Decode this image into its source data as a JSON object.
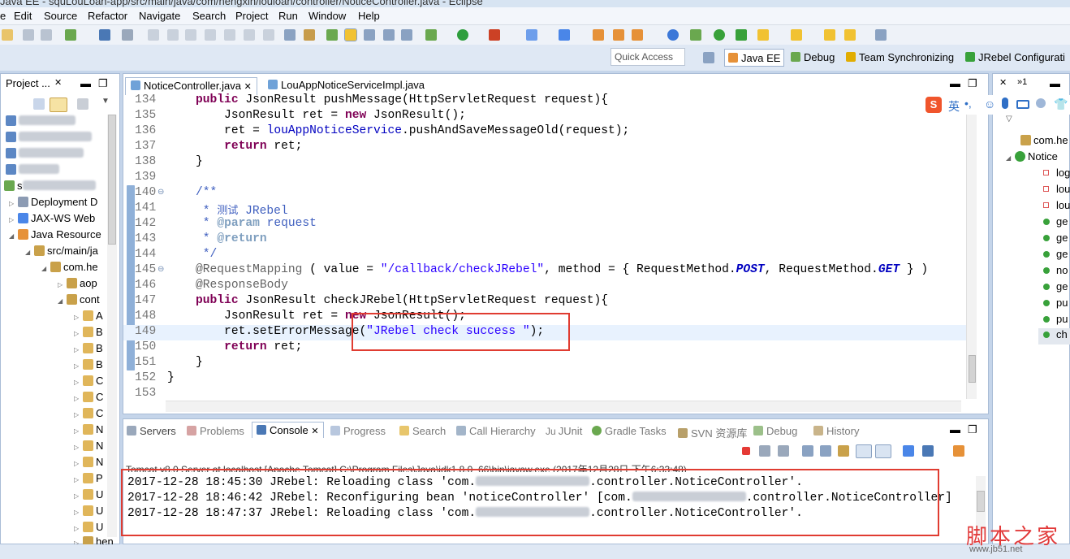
{
  "window": {
    "title": "Java EE - squLouLoan-app/src/main/java/com/hengxin/louloan/controller/NoticeController.java - Eclipse"
  },
  "menu": [
    "e",
    "Edit",
    "Source",
    "Refactor",
    "Navigate",
    "Search",
    "Project",
    "Run",
    "Window",
    "Help"
  ],
  "quick_access": {
    "placeholder": "Quick Access"
  },
  "perspectives": [
    "Java EE",
    "Debug",
    "Team Synchronizing",
    "JRebel Configurati"
  ],
  "project_explorer": {
    "title": "Project ...",
    "items": [
      "s",
      "Deployment D",
      "JAX-WS Web",
      "Java Resource",
      "src/main/ja",
      "com.he",
      "aop",
      "cont",
      "A",
      "B",
      "B",
      "B",
      "C",
      "C",
      "C",
      "N",
      "N",
      "N",
      "P",
      "U",
      "U",
      "U",
      "hen"
    ]
  },
  "editor": {
    "tabs": [
      "NoticeController.java",
      "LouAppNoticeServiceImpl.java"
    ],
    "lines": [
      {
        "n": "134",
        "t": "    public JsonResult pushMessage(HttpServletRequest request){"
      },
      {
        "n": "135",
        "t": "        JsonResult ret = new JsonResult();"
      },
      {
        "n": "136",
        "t": "        ret = louAppNoticeService.pushAndSaveMessageOld(request);"
      },
      {
        "n": "137",
        "t": "        return ret;"
      },
      {
        "n": "138",
        "t": "    }"
      },
      {
        "n": "139",
        "t": ""
      },
      {
        "n": "140",
        "t": "    /**"
      },
      {
        "n": "141",
        "t": "     * 测试 JRebel"
      },
      {
        "n": "142",
        "t": "     * @param request"
      },
      {
        "n": "143",
        "t": "     * @return"
      },
      {
        "n": "144",
        "t": "     */"
      },
      {
        "n": "145",
        "t": "    @RequestMapping ( value = \"/callback/checkJRebel\", method = { RequestMethod.POST, RequestMethod.GET } )"
      },
      {
        "n": "146",
        "t": "    @ResponseBody"
      },
      {
        "n": "147",
        "t": "    public JsonResult checkJRebel(HttpServletRequest request){"
      },
      {
        "n": "148",
        "t": "        JsonResult ret = new JsonResult();"
      },
      {
        "n": "149",
        "t": "        ret.setErrorMessage(\"JRebel check success \");"
      },
      {
        "n": "150",
        "t": "        return ret;"
      },
      {
        "n": "151",
        "t": "    }"
      },
      {
        "n": "152",
        "t": "}"
      },
      {
        "n": "153",
        "t": ""
      }
    ]
  },
  "outline": {
    "header": "»1",
    "items": [
      "com.he",
      "Notice",
      "log",
      "lou",
      "lou",
      "ge",
      "ge",
      "ge",
      "no",
      "ge",
      "pu",
      "pu",
      "ch"
    ]
  },
  "console": {
    "tabs": [
      "Servers",
      "Problems",
      "Console",
      "Progress",
      "Search",
      "Call Hierarchy",
      "JUnit",
      "Gradle Tasks",
      "SVN 资源库",
      "Debug",
      "History"
    ],
    "description": "Tomcat v8.0 Server at localhost [Apache Tomcat] C:\\Program Files\\Java\\jdk1.8.0_66\\bin\\javaw.exe (2017年12月28日 下午6:33:48)",
    "lines": [
      {
        "pre": "2017-12-28 18:45:30 JRebel: Reloading class 'com.",
        "post": ".controller.NoticeController'."
      },
      {
        "pre": "2017-12-28 18:46:42 JRebel: Reconfiguring bean 'noticeController' [com.",
        "post": ".controller.NoticeController]"
      },
      {
        "pre": "2017-12-28 18:47:37 JRebel: Reloading class 'com.",
        "post": ".controller.NoticeController'."
      }
    ]
  },
  "watermark": {
    "text": "脚本之家",
    "url": "www.jb51.net"
  },
  "ime_toolbar": {
    "label": "英"
  }
}
